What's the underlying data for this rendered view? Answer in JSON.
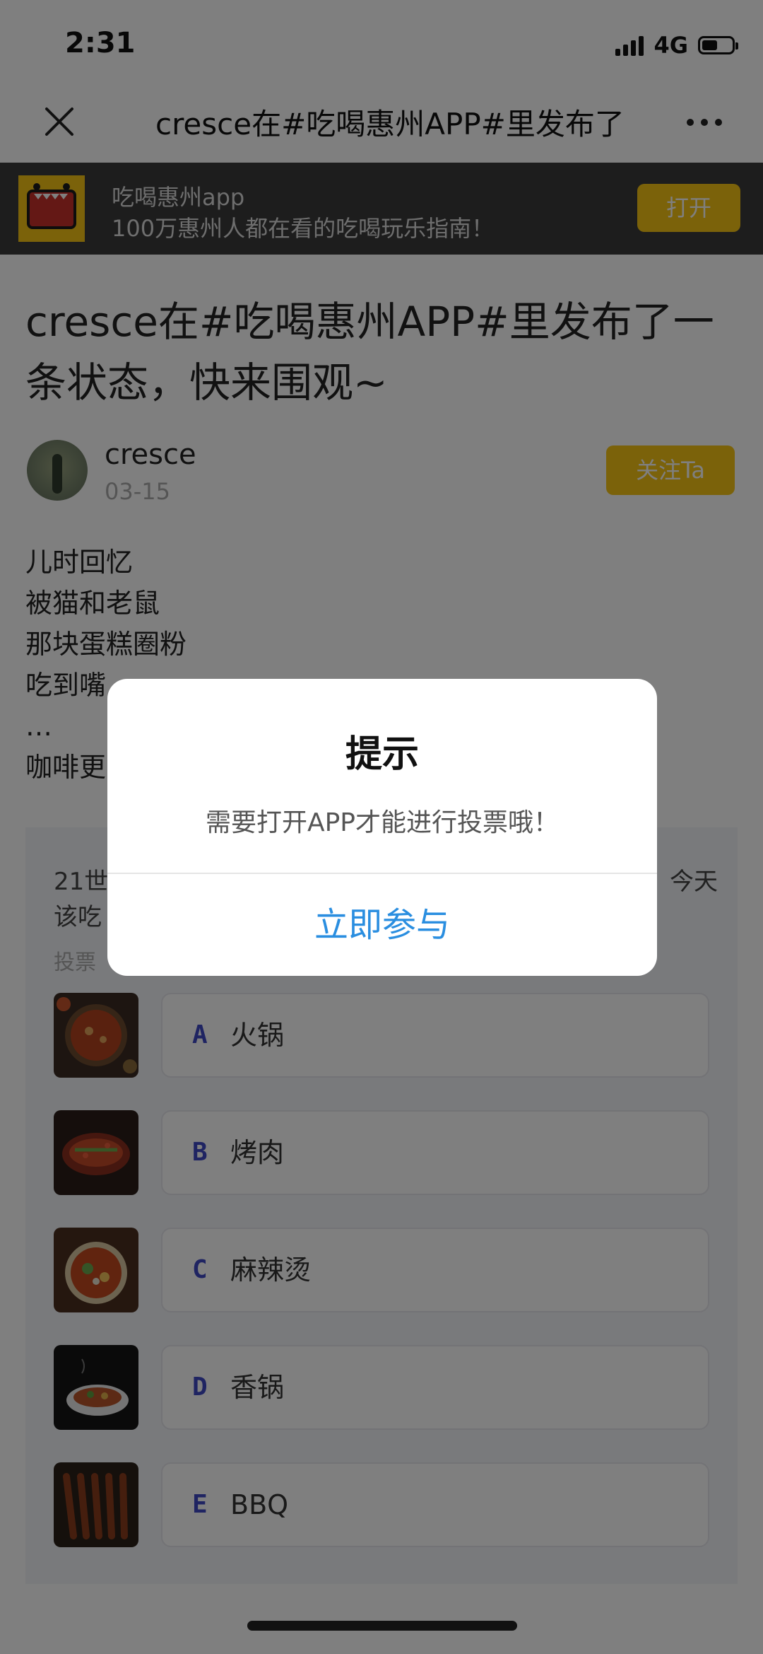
{
  "status_bar": {
    "time": "2:31",
    "network": "4G"
  },
  "nav": {
    "title": "cresce在#吃喝惠州APP#里发布了一条状态，快来围观~",
    "close_icon": "close-icon",
    "more_icon": "more-icon"
  },
  "banner": {
    "app_name": "吃喝惠州app",
    "slogan": "100万惠州人都在看的吃喝玩乐指南！",
    "open_label": "打开"
  },
  "article": {
    "title": "cresce在#吃喝惠州APP#里发布了一条状态，快来围观~",
    "author": "cresce",
    "date": "03-15",
    "follow_label": "关注Ta",
    "lines": [
      "儿时回忆",
      "被猫和老鼠",
      "那块蛋糕圈粉",
      "吃到嘴",
      "…",
      "咖啡更"
    ]
  },
  "poll": {
    "question_left": "21世",
    "question_right": "今天",
    "question_line2": "该吃",
    "hint": "投票",
    "options": [
      {
        "letter": "A",
        "label": "火锅"
      },
      {
        "letter": "B",
        "label": "烤肉"
      },
      {
        "letter": "C",
        "label": "麻辣烫"
      },
      {
        "letter": "D",
        "label": "香锅"
      },
      {
        "letter": "E",
        "label": "BBQ"
      }
    ]
  },
  "dialog": {
    "title": "提示",
    "message": "需要打开APP才能进行投票哦！",
    "action_label": "立即参与"
  },
  "colors": {
    "brand_yellow": "#f6c514",
    "banner_bg": "#3b3b3b",
    "letter_blue": "#3f49c4",
    "action_blue": "#2a8ee0"
  }
}
